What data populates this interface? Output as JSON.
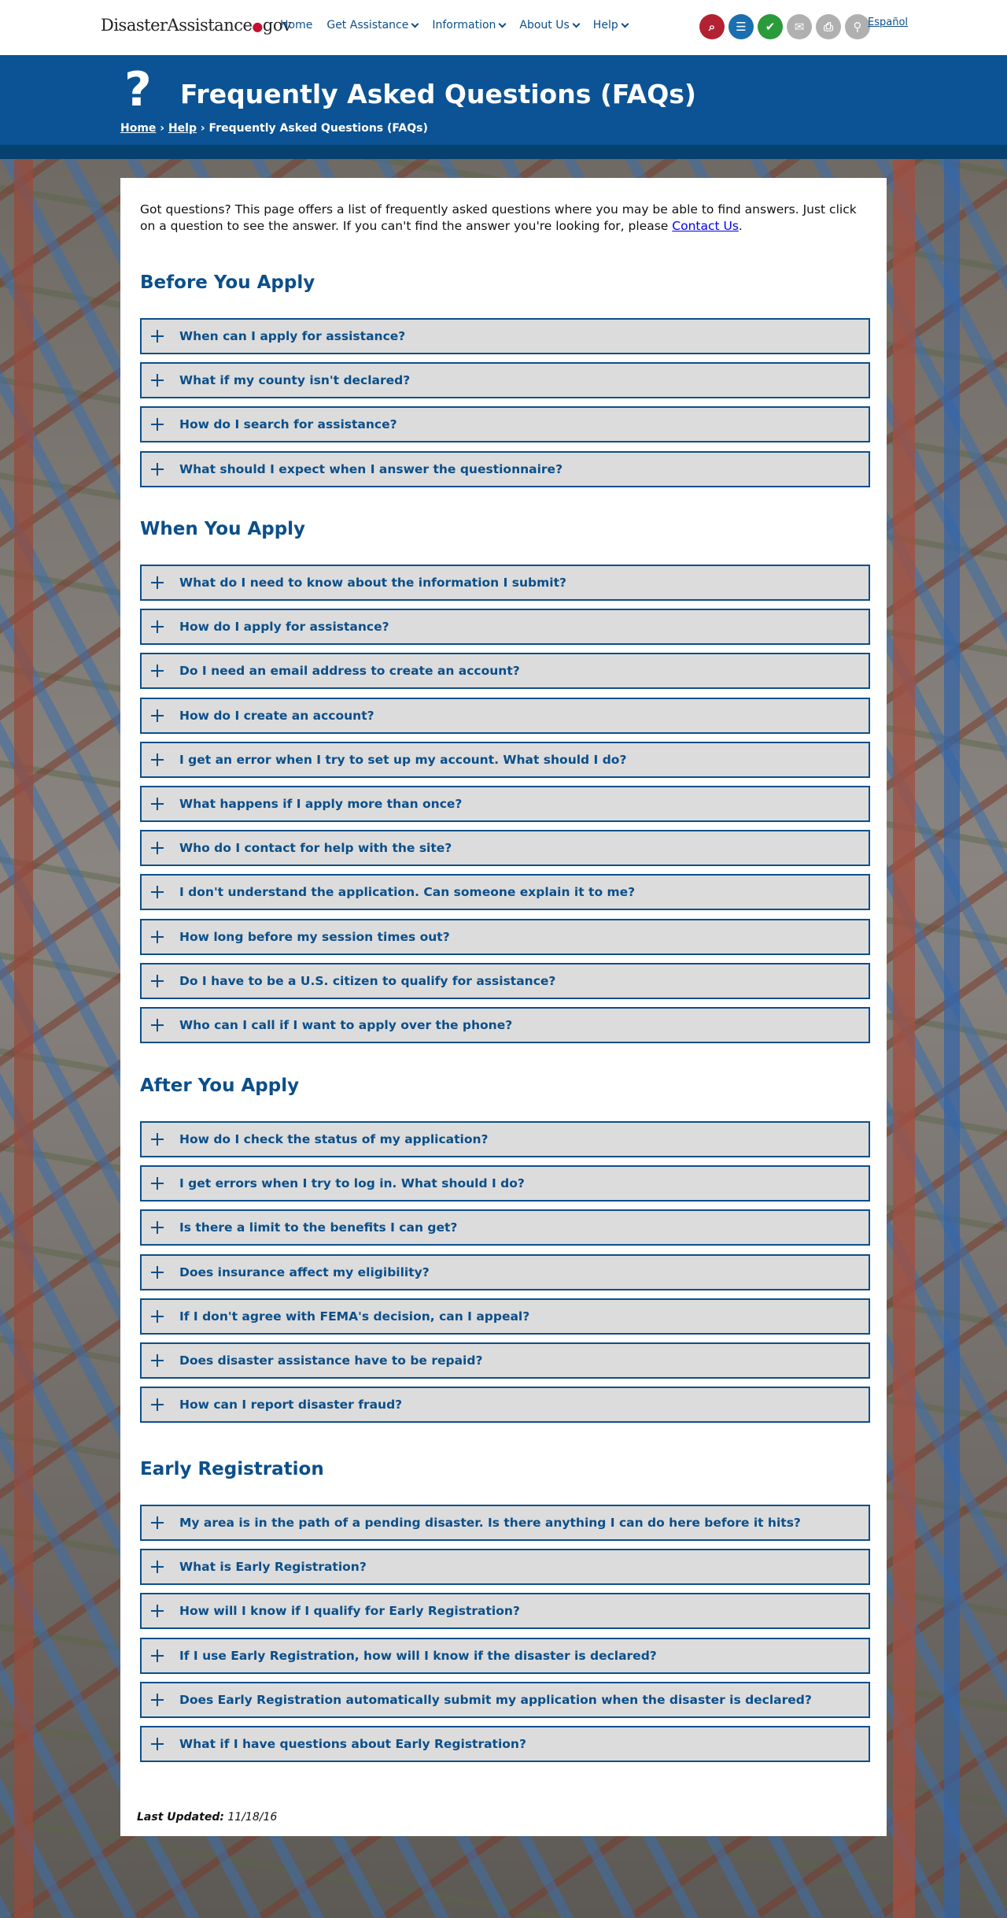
{
  "header": {
    "logo_main": "DisasterAssistance",
    "logo_dot": "●",
    "logo_suffix": "gov",
    "nav": [
      {
        "label": "Home",
        "dropdown": false
      },
      {
        "label": "Get Assistance",
        "dropdown": true
      },
      {
        "label": "Information",
        "dropdown": true
      },
      {
        "label": "About Us",
        "dropdown": true
      },
      {
        "label": "Help",
        "dropdown": true
      }
    ],
    "icons": [
      {
        "name": "search-document-icon",
        "glyph": "⌕",
        "color": "#b22233"
      },
      {
        "name": "clipboard-icon",
        "glyph": "☰",
        "color": "#1a6fb0"
      },
      {
        "name": "checkmark-icon",
        "glyph": "✔",
        "color": "#2a9a3a"
      },
      {
        "name": "email-icon",
        "glyph": "✉",
        "color": "#b0b0b0"
      },
      {
        "name": "print-icon",
        "glyph": "⎙",
        "color": "#b0b0b0"
      },
      {
        "name": "search-icon",
        "glyph": "⚲",
        "color": "#b0b0b0"
      }
    ],
    "language_link": "Español"
  },
  "banner": {
    "icon": "?",
    "title": "Frequently Asked Questions (FAQs)",
    "breadcrumb": {
      "home": "Home",
      "sep1": " › ",
      "help": "Help",
      "sep2": " › ",
      "current": "Frequently Asked Questions (FAQs)"
    }
  },
  "intro": {
    "text": "Got questions? This page offers a list of frequently asked questions where you may be able to find answers. Just click on a question to see the answer. If you can't find the answer you're looking for, please ",
    "link": "Contact Us",
    "end": "."
  },
  "sections": [
    {
      "title": "Before You Apply",
      "questions": [
        "When can I apply for assistance?",
        "What if my county isn't declared?",
        "How do I search for assistance?",
        "What should I expect when I answer the questionnaire?"
      ]
    },
    {
      "title": "When You Apply",
      "questions": [
        "What do I need to know about the information I submit?",
        "How do I apply for assistance?",
        "Do I need an email address to create an account?",
        "How do I create an account?",
        "I get an error when I try to set up my account. What should I do?",
        "What happens if I apply more than once?",
        "Who do I contact for help with the site?",
        "I don't understand the application. Can someone explain it to me?",
        "How long before my session times out?",
        "Do I have to be a U.S. citizen to qualify for assistance?",
        "Who can I call if I want to apply over the phone?"
      ]
    },
    {
      "title": "After You Apply",
      "questions": [
        "How do I check the status of my application?",
        "I get errors when I try to log in. What should I do?",
        "Is there a limit to the benefits I can get?",
        "Does insurance affect my eligibility?",
        "If I don't agree with FEMA's decision, can I appeal?",
        "Does disaster assistance have to be repaid?",
        "How can I report disaster fraud?"
      ]
    },
    {
      "title": "Early Registration",
      "questions": [
        "My area is in the path of a pending disaster. Is there anything I can do here before it hits?",
        "What is Early Registration?",
        "How will I know if I qualify for Early Registration?",
        "If I use Early Registration, how will I know if the disaster is declared?",
        "Does Early Registration automatically submit my application when the disaster is declared?",
        "What if I have questions about Early Registration?"
      ]
    }
  ],
  "footer": {
    "updated_label": "Last Updated:",
    "updated_date": "11/18/16"
  }
}
